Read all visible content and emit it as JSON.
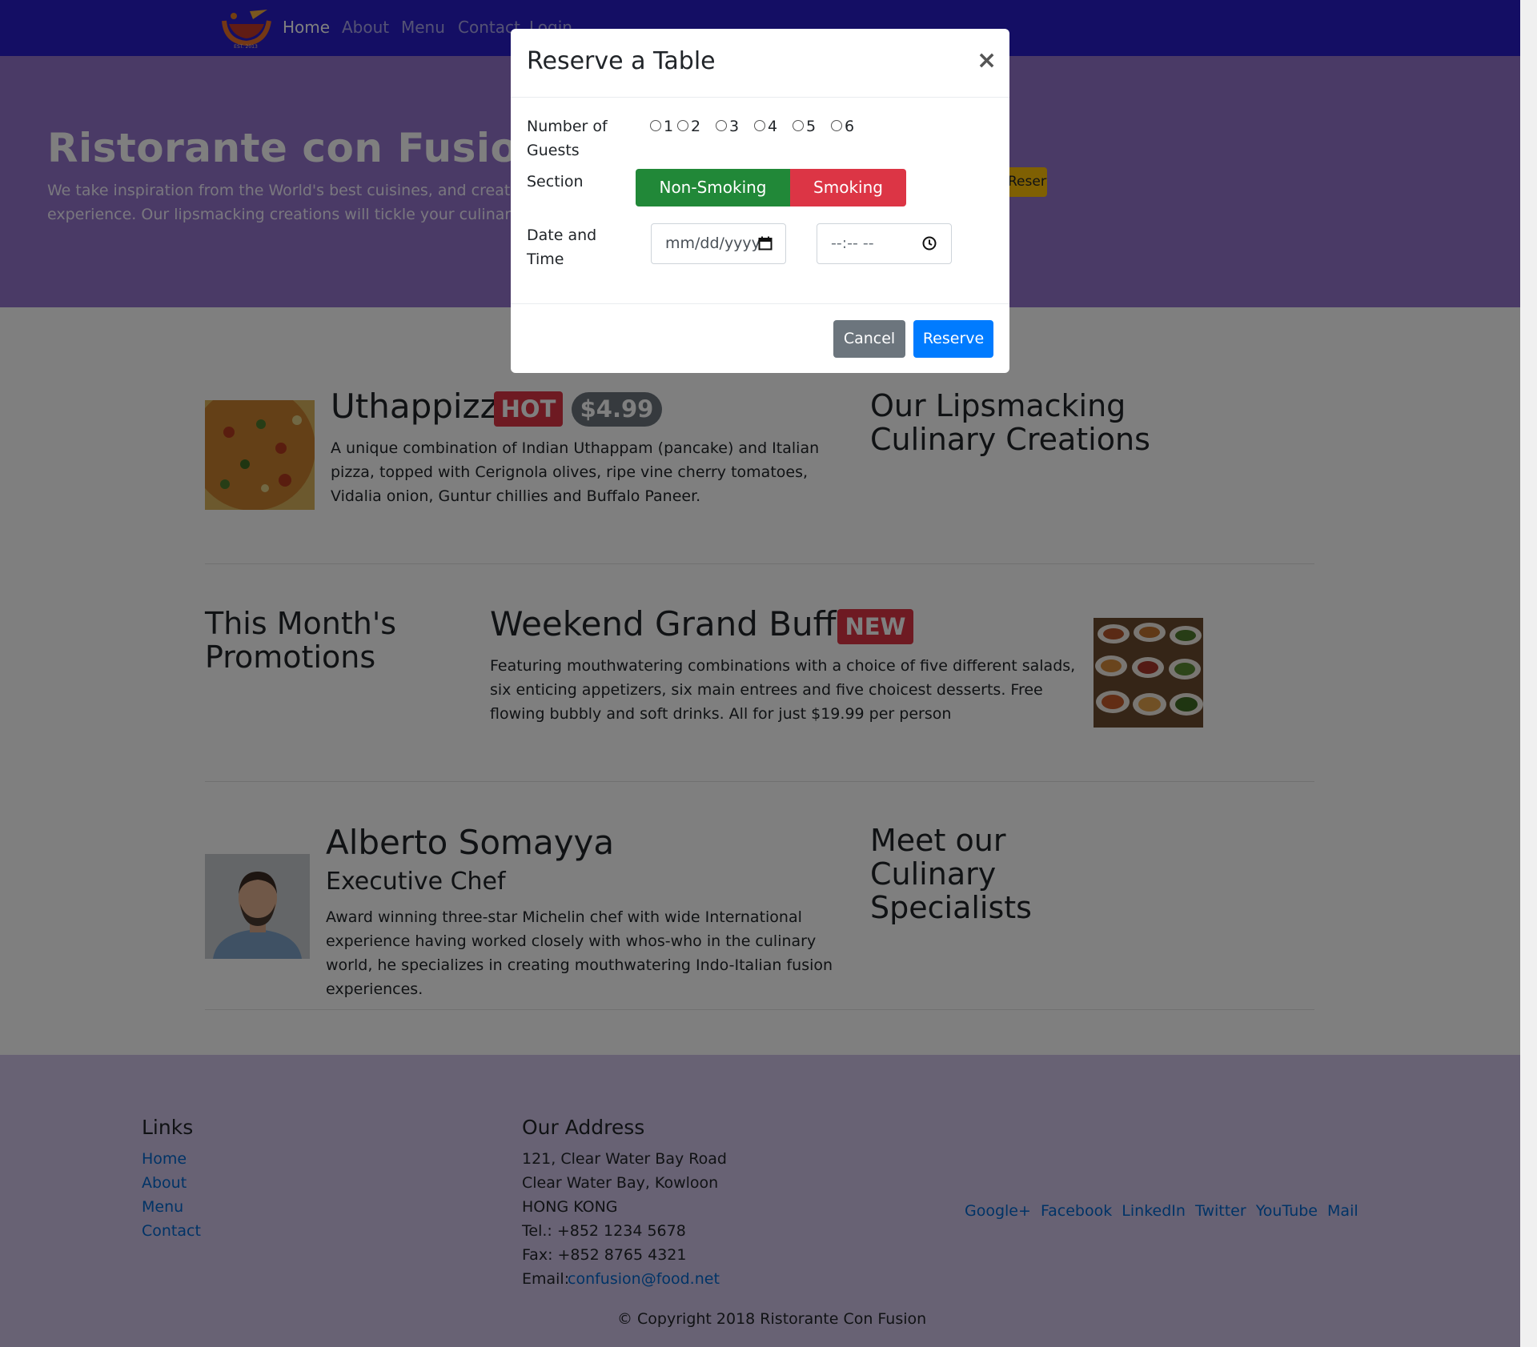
{
  "navbar": {
    "logo_text": "EST. 2013",
    "items": [
      {
        "label": "Home",
        "active": true
      },
      {
        "label": "About",
        "active": false
      },
      {
        "label": "Menu",
        "active": false
      },
      {
        "label": "Contact",
        "active": false
      },
      {
        "label": "Login",
        "active": false
      }
    ]
  },
  "jumbotron": {
    "title": "Ristorante con Fusion",
    "text": "We take inspiration from the World's best cuisines, and create a unique fusion experience. Our lipsmacking creations will tickle your culinary senses!",
    "reserve_button": "Reserve Table"
  },
  "dish": {
    "name": "Uthappizza",
    "badge": "HOT",
    "price": "$4.99",
    "description": "A unique combination of Indian Uthappam (pancake) and Italian pizza, topped with Cerignola olives, ripe vine cherry tomatoes, Vidalia onion, Guntur chillies and Buffalo Paneer.",
    "heading": "Our Lipsmacking Culinary Creations"
  },
  "promotion": {
    "heading": "This Month's Promotions",
    "name": "Weekend Grand Buffet",
    "badge": "NEW",
    "description": "Featuring mouthwatering combinations with a choice of five different salads, six enticing appetizers, six main entrees and five choicest desserts. Free flowing bubbly and soft drinks. All for just $19.99 per person"
  },
  "chef": {
    "name": "Alberto Somayya",
    "title": "Executive Chef",
    "description": "Award winning three-star Michelin chef with wide International experience having worked closely with whos-who in the culinary world, he specializes in creating mouthwatering Indo-Italian fusion experiences.",
    "heading": "Meet our Culinary Specialists"
  },
  "footer": {
    "links_heading": "Links",
    "links": [
      "Home",
      "About",
      "Menu",
      "Contact"
    ],
    "address_heading": "Our Address",
    "address": [
      "121, Clear Water Bay Road",
      "Clear Water Bay, Kowloon",
      "HONG KONG"
    ],
    "tel": "Tel.: +852 1234 5678",
    "fax": "Fax: +852 8765 4321",
    "email_label": "Email: ",
    "email": "confusion@food.net",
    "social": [
      "Google+",
      "Facebook",
      "LinkedIn",
      "Twitter",
      "YouTube",
      "Mail"
    ],
    "copyright": "© Copyright 2018 Ristorante Con Fusion"
  },
  "modal": {
    "title": "Reserve a Table",
    "close": "×",
    "guests_label": "Number of Guests",
    "guest_options": [
      "1",
      "2",
      "3",
      "4",
      "5",
      "6"
    ],
    "section_label": "Section",
    "non_smoking": "Non-Smoking",
    "smoking": "Smoking",
    "datetime_label": "Date and Time",
    "date_placeholder": "mm/dd/yyyy",
    "time_placeholder": "--:-- --",
    "cancel": "Cancel",
    "reserve": "Reserve",
    "colors": {
      "non_smoking": "#218838",
      "smoking": "#DC3545",
      "reserve": "#007BFF",
      "cancel": "#6C757D"
    }
  }
}
